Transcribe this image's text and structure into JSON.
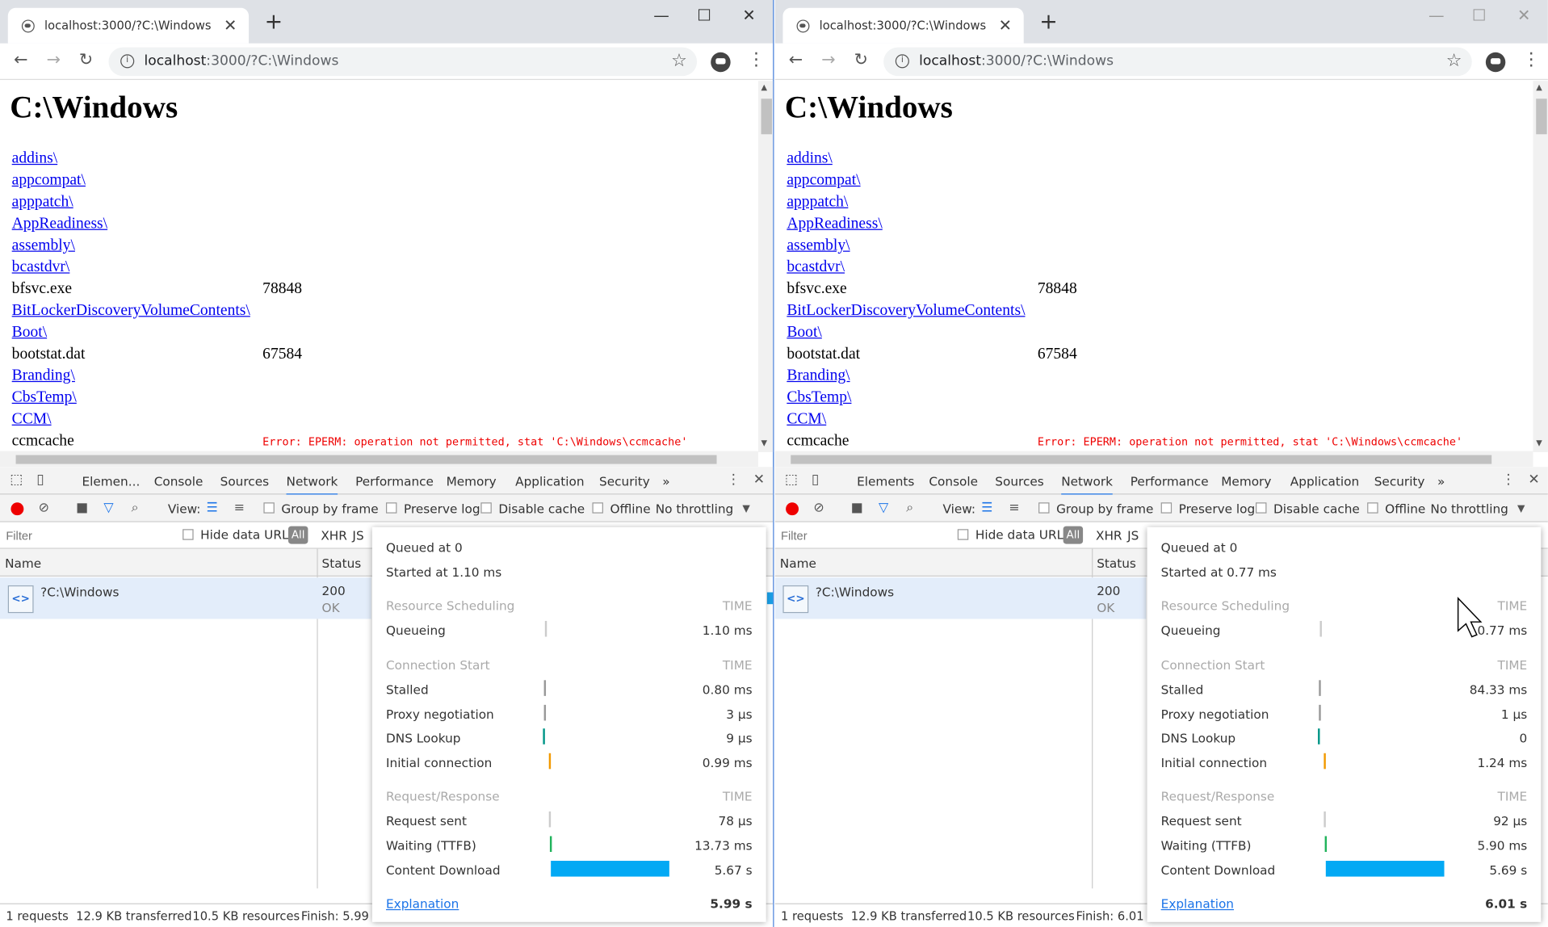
{
  "browser": {
    "tab_title": "localhost:3000/?C:\\Windows",
    "url_host": "localhost",
    "url_path": ":3000/?C:\\Windows",
    "close_glyph": "✕",
    "newtab_glyph": "+",
    "minimize_glyph": "—",
    "maximize_glyph": "☐",
    "winclose_glyph": "✕",
    "back_glyph": "←",
    "forward_glyph": "→",
    "reload_glyph": "↻",
    "info_glyph": "i",
    "star_glyph": "☆",
    "menu_glyph": "⋮"
  },
  "page": {
    "heading": "C:\\Windows",
    "entries": [
      {
        "name": "addins\\",
        "link": true,
        "size": "",
        "error": ""
      },
      {
        "name": "appcompat\\",
        "link": true,
        "size": "",
        "error": ""
      },
      {
        "name": "apppatch\\",
        "link": true,
        "size": "",
        "error": ""
      },
      {
        "name": "AppReadiness\\",
        "link": true,
        "size": "",
        "error": ""
      },
      {
        "name": "assembly\\",
        "link": true,
        "size": "",
        "error": ""
      },
      {
        "name": "bcastdvr\\",
        "link": true,
        "size": "",
        "error": ""
      },
      {
        "name": "bfsvc.exe",
        "link": false,
        "size": "78848",
        "error": ""
      },
      {
        "name": "BitLockerDiscoveryVolumeContents\\",
        "link": true,
        "size": "",
        "error": ""
      },
      {
        "name": "Boot\\",
        "link": true,
        "size": "",
        "error": ""
      },
      {
        "name": "bootstat.dat",
        "link": false,
        "size": "67584",
        "error": ""
      },
      {
        "name": "Branding\\",
        "link": true,
        "size": "",
        "error": ""
      },
      {
        "name": "CbsTemp\\",
        "link": true,
        "size": "",
        "error": ""
      },
      {
        "name": "CCM\\",
        "link": true,
        "size": "",
        "error": ""
      },
      {
        "name": "ccmcache",
        "link": false,
        "size": "",
        "error": "Error: EPERM: operation not permitted, stat 'C:\\Windows\\ccmcache'"
      }
    ]
  },
  "devtools": {
    "tabs": [
      "Elemen...",
      "Console",
      "Sources",
      "Network",
      "Performance",
      "Memory",
      "Application",
      "Security"
    ],
    "tabs_full": [
      "Elements",
      "Console",
      "Sources",
      "Network",
      "Performance",
      "Memory",
      "Application",
      "Security"
    ],
    "more_glyph": "»",
    "view_label": "View:",
    "group_by_frame": "Group by frame",
    "preserve_log": "Preserve log",
    "disable_cache": "Disable cache",
    "offline": "Offline",
    "throttling": "No throttling",
    "filter_placeholder": "Filter",
    "hide_data_urls": "Hide data URLs",
    "filter_all": "All",
    "filter_xhr": "XHR",
    "filter_js": "JS",
    "col_name": "Name",
    "col_status": "Status",
    "request_name": "?C:\\Windows",
    "status_code": "200",
    "status_text": "OK",
    "summary": {
      "requests": "1 requests",
      "transferred": "12.9 KB transferred",
      "resources": "10.5 KB resources"
    }
  },
  "timing_labels": {
    "resource_scheduling": "Resource Scheduling",
    "connection_start": "Connection Start",
    "request_response": "Request/Response",
    "time": "TIME",
    "queueing": "Queueing",
    "stalled": "Stalled",
    "proxy": "Proxy negotiation",
    "dns": "DNS Lookup",
    "initial": "Initial connection",
    "request_sent": "Request sent",
    "waiting": "Waiting (TTFB)",
    "download": "Content Download",
    "explanation": "Explanation"
  },
  "left": {
    "finish": "Finish: 5.99 s",
    "queued_at": "Queued at 0",
    "started_at": "Started at 1.10 ms",
    "queueing": "1.10 ms",
    "stalled": "0.80 ms",
    "proxy": "3 µs",
    "dns": "9 µs",
    "initial": "0.99 ms",
    "request_sent": "78 µs",
    "waiting": "13.73 ms",
    "download": "5.67 s",
    "total": "5.99 s"
  },
  "right": {
    "finish": "Finish: 6.01 s",
    "queued_at": "Queued at 0",
    "started_at": "Started at 0.77 ms",
    "queueing": "0.77 ms",
    "stalled": "84.33 ms",
    "proxy": "1 µs",
    "dns": "0",
    "initial": "1.24 ms",
    "request_sent": "92 µs",
    "waiting": "5.90 ms",
    "download": "5.69 s",
    "total": "6.01 s"
  },
  "colors": {
    "queue": "#cccccc",
    "stalled": "#999999",
    "dns": "#009688",
    "initial": "#f29900",
    "waiting": "#21b35c",
    "download": "#03a9f4",
    "link": "#0000ee",
    "error": "#ee0000"
  }
}
